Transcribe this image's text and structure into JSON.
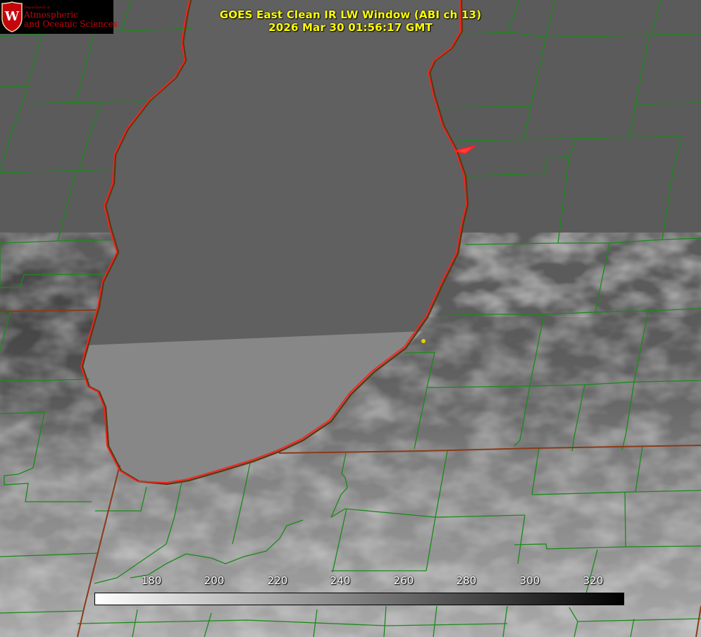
{
  "header": {
    "title_line1": "GOES East Clean IR LW Window (ABI ch 13)",
    "title_line2": "2026 Mar 30 01:56:17 GMT"
  },
  "logo": {
    "dept_small": "Department of",
    "dept_line1": "Atmospheric",
    "dept_line2": "and Oceanic Sciences",
    "crest_letter": "W"
  },
  "colorbar": {
    "ticks": [
      "180",
      "200",
      "220",
      "240",
      "260",
      "280",
      "300",
      "320"
    ],
    "gradient": [
      "#ffffff",
      "#000000"
    ]
  },
  "colors": {
    "county_lines": "#1a8a1a",
    "coastline": "#ff2020",
    "state_lines": "#8b3a1a",
    "title_text": "#ffff00",
    "marker": "#e0d000"
  }
}
